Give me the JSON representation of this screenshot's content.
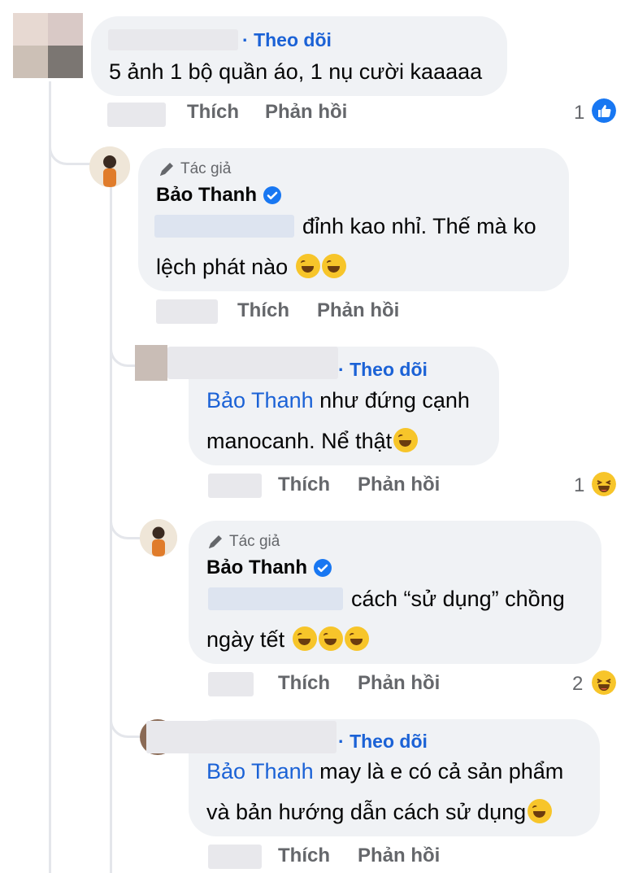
{
  "comments": [
    {
      "follow_label": "Theo dõi",
      "line1": "5 ảnh 1 bộ quần áo, 1 nụ cười kaaaaa",
      "like": "Thích",
      "reply": "Phản hồi",
      "reaction_count": "1"
    },
    {
      "author_tag": "Tác giả",
      "name": "Bảo Thanh",
      "line1": "đỉnh kao nhỉ. Thế mà ko",
      "line2": "lệch phát nào",
      "like": "Thích",
      "reply": "Phản hồi"
    },
    {
      "follow_label": "Theo dõi",
      "mention": "Bảo Thanh",
      "line1": " như đứng cạnh",
      "line2": "manocanh. Nể thật",
      "like": "Thích",
      "reply": "Phản hồi",
      "reaction_count": "1"
    },
    {
      "author_tag": "Tác giả",
      "name": "Bảo Thanh",
      "line1": "cách “sử dụng” chồng",
      "line2": "ngày tết",
      "like": "Thích",
      "reply": "Phản hồi",
      "reaction_count": "2"
    },
    {
      "follow_label": "Theo dõi",
      "mention": "Bảo Thanh",
      "line1": " may là e có cả sản phẩm",
      "line2": "và bản hướng dẫn cách sử dụng",
      "like": "Thích",
      "reply": "Phản hồi"
    }
  ],
  "icons": {
    "like_reaction": "like-icon",
    "haha_reaction": "haha-icon",
    "laugh_emoji": "rofl-emoji",
    "verified": "verified-badge-icon",
    "author": "pen-icon"
  },
  "colors": {
    "link": "#1b62d6",
    "bubble": "#f0f2f5",
    "meta": "#65676b"
  }
}
